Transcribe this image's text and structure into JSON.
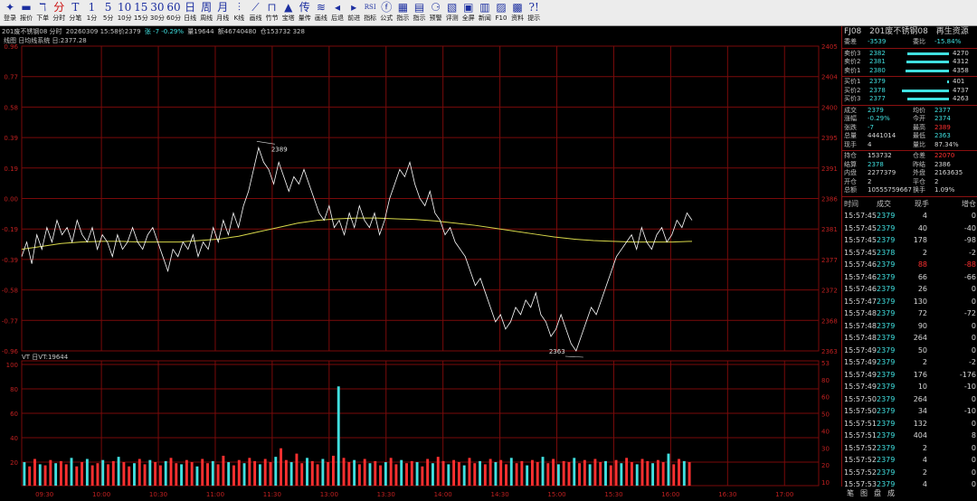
{
  "toolbar": [
    {
      "icon": "logo-icon",
      "glyph": "✦",
      "label": "登录",
      "red": false
    },
    {
      "icon": "quote-icon",
      "glyph": "▬",
      "label": "报价",
      "red": false
    },
    {
      "icon": "order-icon",
      "glyph": "ℸ",
      "label": "下单",
      "red": false
    },
    {
      "icon": "timeshare-icon",
      "glyph": "分",
      "label": "分时",
      "red": true
    },
    {
      "icon": "tick-icon",
      "glyph": "T",
      "label": "分笔",
      "red": false
    },
    {
      "icon": "1min-icon",
      "glyph": "1",
      "label": "1分",
      "red": false
    },
    {
      "icon": "5min-icon",
      "glyph": "5",
      "label": "5分",
      "red": false
    },
    {
      "icon": "10min-icon",
      "glyph": "10",
      "label": "10分",
      "red": false
    },
    {
      "icon": "15min-icon",
      "glyph": "15",
      "label": "15分",
      "red": false
    },
    {
      "icon": "30min-icon",
      "glyph": "30",
      "label": "30分",
      "red": false
    },
    {
      "icon": "60min-icon",
      "glyph": "60",
      "label": "60分",
      "red": false
    },
    {
      "icon": "daily-icon",
      "glyph": "日",
      "label": "日线",
      "red": false
    },
    {
      "icon": "weekly-icon",
      "glyph": "周",
      "label": "周线",
      "red": false
    },
    {
      "icon": "monthly-icon",
      "glyph": "月",
      "label": "月线",
      "red": false
    },
    {
      "icon": "kline-icon",
      "glyph": "⫶",
      "label": "K线",
      "red": false
    },
    {
      "icon": "draw-line-icon",
      "glyph": "⟋",
      "label": "画线",
      "red": false
    },
    {
      "icon": "bamboo-icon",
      "glyph": "⊓",
      "label": "竹节",
      "red": false
    },
    {
      "icon": "tower-icon",
      "glyph": "▲",
      "label": "宝塔",
      "red": false
    },
    {
      "icon": "volume-price-icon",
      "glyph": "传",
      "label": "量传",
      "red": false
    },
    {
      "icon": "draw-icon",
      "glyph": "≋",
      "label": "画线",
      "red": false
    },
    {
      "icon": "back-icon",
      "glyph": "◂",
      "label": "后退",
      "red": false
    },
    {
      "icon": "forward-icon",
      "glyph": "▸",
      "label": "前进",
      "red": false
    },
    {
      "icon": "rsi-icon",
      "glyph": "RSI",
      "label": "指标",
      "red": false
    },
    {
      "icon": "formula-icon",
      "glyph": "ⓕ",
      "label": "公式",
      "red": false
    },
    {
      "icon": "indicator-icon",
      "glyph": "▦",
      "label": "指示",
      "red": false
    },
    {
      "icon": "hint-icon",
      "glyph": "▤",
      "label": "指示",
      "red": false
    },
    {
      "icon": "alert-icon",
      "glyph": "⚆",
      "label": "预警",
      "red": false
    },
    {
      "icon": "review-icon",
      "glyph": "▧",
      "label": "评测",
      "red": false
    },
    {
      "icon": "fullscreen-icon",
      "glyph": "▣",
      "label": "全屏",
      "red": false
    },
    {
      "icon": "news-icon",
      "glyph": "▥",
      "label": "新闻",
      "red": false
    },
    {
      "icon": "f10-icon",
      "glyph": "▨",
      "label": "F10",
      "red": false
    },
    {
      "icon": "disabled-icon",
      "glyph": "▩",
      "label": "资料",
      "red": false
    },
    {
      "icon": "tips-icon",
      "glyph": "?!",
      "label": "提示",
      "red": false
    }
  ],
  "infobar": {
    "contract": "201废不锈钢08 分时",
    "time": "20260309 15:58价2379",
    "change": "张 -7 -0.29%",
    "volume": "量19644",
    "amount": "额46740480",
    "oi": "仓153732 328"
  },
  "price_chart": {
    "header": "线图 日均线系统 日:2377.28",
    "left_ticks": [
      "0.96",
      "0.77",
      "0.58",
      "0.39",
      "0.19",
      "0.00",
      "-0.19",
      "-0.39",
      "-0.58",
      "-0.77",
      "-0.96"
    ],
    "right_ticks": [
      "2405",
      "2404",
      "2400",
      "2395",
      "2391",
      "2386",
      "2381",
      "2377",
      "2372",
      "2368",
      "2363"
    ],
    "high_label": "2389",
    "low_label": "2363"
  },
  "volume_chart": {
    "header": "VT 日VT:19644",
    "left_ticks": [
      "100",
      "80",
      "60",
      "40",
      "20"
    ],
    "right_ticks": [
      "53",
      "80",
      "60",
      "50",
      "40",
      "30",
      "20",
      "10"
    ],
    "time_ticks": [
      "09:30",
      "10:00",
      "10:30",
      "11:00",
      "11:30",
      "13:00",
      "13:30",
      "14:00",
      "14:30",
      "15:00",
      "15:30",
      "16:00",
      "16:30",
      "17:00"
    ]
  },
  "chart_data": {
    "type": "line",
    "title": "201废不锈钢08 分时",
    "ylabel": "",
    "ylim": [
      2363,
      2405
    ],
    "series": [
      {
        "name": "价格",
        "values": [
          2376,
          2378,
          2375,
          2379,
          2377,
          2380,
          2378,
          2381,
          2379,
          2380,
          2378,
          2381,
          2379,
          2378,
          2380,
          2377,
          2379,
          2378,
          2376,
          2379,
          2377,
          2378,
          2380,
          2378,
          2377,
          2379,
          2380,
          2378,
          2376,
          2374,
          2377,
          2376,
          2378,
          2377,
          2379,
          2376,
          2378,
          2377,
          2380,
          2378,
          2381,
          2379,
          2382,
          2380,
          2383,
          2385,
          2388,
          2391,
          2389,
          2388,
          2386,
          2389,
          2387,
          2385,
          2387,
          2386,
          2388,
          2386,
          2384,
          2382,
          2381,
          2383,
          2380,
          2381,
          2379,
          2382,
          2380,
          2383,
          2381,
          2380,
          2382,
          2379,
          2381,
          2384,
          2386,
          2388,
          2387,
          2389,
          2386,
          2384,
          2383,
          2385,
          2382,
          2381,
          2379,
          2380,
          2378,
          2377,
          2376,
          2374,
          2372,
          2373,
          2371,
          2369,
          2367,
          2368,
          2366,
          2367,
          2369,
          2368,
          2370,
          2369,
          2371,
          2368,
          2367,
          2365,
          2366,
          2368,
          2366,
          2364,
          2363,
          2365,
          2367,
          2369,
          2368,
          2370,
          2372,
          2374,
          2376,
          2377,
          2378,
          2379,
          2377,
          2380,
          2378,
          2377,
          2379,
          2380,
          2378,
          2379,
          2381,
          2380,
          2382,
          2381
        ]
      },
      {
        "name": "均价",
        "values": [
          2377.0,
          2377.4,
          2377.8,
          2378.0,
          2378.1,
          2378.1,
          2378.0,
          2378.0,
          2378.0,
          2378.2,
          2378.4,
          2378.8,
          2379.4,
          2380.0,
          2380.6,
          2381.0,
          2381.2,
          2381.3,
          2381.3,
          2381.2,
          2381.1,
          2380.9,
          2380.6,
          2380.3,
          2379.9,
          2379.5,
          2379.1,
          2378.7,
          2378.4,
          2378.2,
          2378.1,
          2378.0,
          2378.0,
          2378.0,
          2378.1
        ]
      }
    ]
  },
  "volume_data": {
    "type": "bar",
    "values": [
      22,
      18,
      25,
      20,
      19,
      24,
      21,
      23,
      20,
      26,
      18,
      22,
      25,
      19,
      21,
      24,
      20,
      23,
      27,
      22,
      18,
      21,
      25,
      20,
      24,
      22,
      19,
      23,
      26,
      21,
      20,
      24,
      22,
      18,
      25,
      21,
      23,
      20,
      28,
      22,
      19,
      24,
      21,
      26,
      23,
      20,
      25,
      22,
      27,
      35,
      24,
      22,
      30,
      21,
      26,
      23,
      20,
      25,
      22,
      28,
      93,
      26,
      22,
      24,
      20,
      25,
      21,
      23,
      19,
      22,
      26,
      20,
      24,
      21,
      23,
      22,
      18,
      25,
      21,
      27,
      23,
      20,
      24,
      22,
      19,
      26,
      21,
      23,
      20,
      25,
      22,
      24,
      20,
      26,
      21,
      23,
      19,
      24,
      22,
      27,
      21,
      25,
      20,
      23,
      22,
      26,
      21,
      24,
      20,
      25,
      22,
      23,
      19,
      24,
      21,
      26,
      22,
      20,
      25,
      23,
      21,
      24,
      22,
      30,
      20,
      25,
      23,
      22
    ]
  },
  "quote_panel": {
    "code": "FJ08",
    "name": "201废不锈钢08",
    "tag": "再生资源",
    "ratio_label": "委差",
    "ratio_value": "-3539",
    "bid_ratio_label": "委比",
    "bid_ratio_value": "-15.84%",
    "asks": [
      {
        "label": "卖价3",
        "price": "2382",
        "vol": "4270",
        "bar": 0.82
      },
      {
        "label": "卖价2",
        "price": "2381",
        "vol": "4312",
        "bar": 0.84
      },
      {
        "label": "卖价1",
        "price": "2380",
        "vol": "4358",
        "bar": 0.86
      }
    ],
    "bids": [
      {
        "label": "买价1",
        "price": "2379",
        "vol": "401",
        "bar": 0.03
      },
      {
        "label": "买价2",
        "price": "2378",
        "vol": "4737",
        "bar": 0.92
      },
      {
        "label": "买价3",
        "price": "2377",
        "vol": "4263",
        "bar": 0.83
      }
    ],
    "stats": [
      {
        "l1": "成交",
        "v1": "2379",
        "c1": "c-cy",
        "l2": "均价",
        "v2": "2377",
        "c2": "c-cy"
      },
      {
        "l1": "涨幅",
        "v1": "-0.29%",
        "c1": "c-cy",
        "l2": "今开",
        "v2": "2374",
        "c2": "c-cy"
      },
      {
        "l1": "张跌",
        "v1": "-7",
        "c1": "c-cy",
        "l2": "最高",
        "v2": "2389",
        "c2": "c-red"
      },
      {
        "l1": "总量",
        "v1": "4441014",
        "c1": "c-w",
        "l2": "最低",
        "v2": "2363",
        "c2": "c-cy"
      },
      {
        "l1": "现手",
        "v1": "4",
        "c1": "c-w",
        "l2": "量比",
        "v2": "87.34%",
        "c2": "c-w"
      }
    ],
    "stats2": [
      {
        "l1": "持仓",
        "v1": "153732",
        "c1": "c-w",
        "l2": "仓差",
        "v2": "22070",
        "c2": "c-red"
      },
      {
        "l1": "结算",
        "v1": "2378",
        "c1": "c-cy",
        "l2": "昨结",
        "v2": "2386",
        "c2": "c-w"
      },
      {
        "l1": "内盘",
        "v1": "2277379",
        "c1": "c-w",
        "l2": "外盘",
        "v2": "2163635",
        "c2": "c-w"
      },
      {
        "l1": "开仓",
        "v1": "2",
        "c1": "c-w",
        "l2": "平仓",
        "v2": "2",
        "c2": "c-w"
      },
      {
        "l1": "总额",
        "v1": "10555759667",
        "c1": "c-w",
        "l2": "换手",
        "v2": "1.09%",
        "c2": "c-w"
      }
    ],
    "trade_header": {
      "time": "时间",
      "price": "成交",
      "qty": "现手",
      "oi": "增仓"
    },
    "trades": [
      {
        "time": "15:57:45",
        "price": "2379",
        "qty": "4",
        "oi": "0",
        "qc": "c-w",
        "oc": "c-w"
      },
      {
        "time": "15:57:45",
        "price": "2379",
        "qty": "40",
        "oi": "-40",
        "qc": "c-w",
        "oc": "c-w"
      },
      {
        "time": "15:57:45",
        "price": "2379",
        "qty": "178",
        "oi": "-98",
        "qc": "c-w",
        "oc": "c-w"
      },
      {
        "time": "15:57:45",
        "price": "2378",
        "qty": "2",
        "oi": "-2",
        "qc": "c-w",
        "oc": "c-w"
      },
      {
        "time": "15:57:46",
        "price": "2379",
        "qty": "88",
        "oi": "-88",
        "qc": "c-red",
        "oc": "c-red"
      },
      {
        "time": "15:57:46",
        "price": "2379",
        "qty": "66",
        "oi": "-66",
        "qc": "c-w",
        "oc": "c-w"
      },
      {
        "time": "15:57:46",
        "price": "2379",
        "qty": "26",
        "oi": "0",
        "qc": "c-w",
        "oc": "c-w"
      },
      {
        "time": "15:57:47",
        "price": "2379",
        "qty": "130",
        "oi": "0",
        "qc": "c-w",
        "oc": "c-w"
      },
      {
        "time": "15:57:48",
        "price": "2379",
        "qty": "72",
        "oi": "-72",
        "qc": "c-w",
        "oc": "c-w"
      },
      {
        "time": "15:57:48",
        "price": "2379",
        "qty": "90",
        "oi": "0",
        "qc": "c-w",
        "oc": "c-w"
      },
      {
        "time": "15:57:48",
        "price": "2379",
        "qty": "264",
        "oi": "0",
        "qc": "c-w",
        "oc": "c-w"
      },
      {
        "time": "15:57:49",
        "price": "2379",
        "qty": "50",
        "oi": "0",
        "qc": "c-w",
        "oc": "c-w"
      },
      {
        "time": "15:57:49",
        "price": "2379",
        "qty": "2",
        "oi": "-2",
        "qc": "c-w",
        "oc": "c-w"
      },
      {
        "time": "15:57:49",
        "price": "2379",
        "qty": "176",
        "oi": "-176",
        "qc": "c-w",
        "oc": "c-w"
      },
      {
        "time": "15:57:49",
        "price": "2379",
        "qty": "10",
        "oi": "-10",
        "qc": "c-w",
        "oc": "c-w"
      },
      {
        "time": "15:57:50",
        "price": "2379",
        "qty": "264",
        "oi": "0",
        "qc": "c-w",
        "oc": "c-w"
      },
      {
        "time": "15:57:50",
        "price": "2379",
        "qty": "34",
        "oi": "-10",
        "qc": "c-w",
        "oc": "c-w"
      },
      {
        "time": "15:57:51",
        "price": "2379",
        "qty": "132",
        "oi": "0",
        "qc": "c-w",
        "oc": "c-w"
      },
      {
        "time": "15:57:51",
        "price": "2379",
        "qty": "404",
        "oi": "8",
        "qc": "c-w",
        "oc": "c-w"
      },
      {
        "time": "15:57:52",
        "price": "2379",
        "qty": "2",
        "oi": "0",
        "qc": "c-w",
        "oc": "c-w"
      },
      {
        "time": "15:57:52",
        "price": "2379",
        "qty": "4",
        "oi": "0",
        "qc": "c-w",
        "oc": "c-w"
      },
      {
        "time": "15:57:52",
        "price": "2379",
        "qty": "2",
        "oi": "0",
        "qc": "c-w",
        "oc": "c-w"
      },
      {
        "time": "15:57:53",
        "price": "2379",
        "qty": "4",
        "oi": "0",
        "qc": "c-w",
        "oc": "c-w"
      }
    ],
    "bottom_tabs": [
      "笔",
      "图",
      "盘",
      "成"
    ]
  },
  "colors": {
    "grid": "#7a0a0a",
    "price_line": "#ffffff",
    "avg_line": "#d8d84a",
    "up": "#ff3030",
    "down": "#40e0e0",
    "axis_red": "#c02020"
  }
}
